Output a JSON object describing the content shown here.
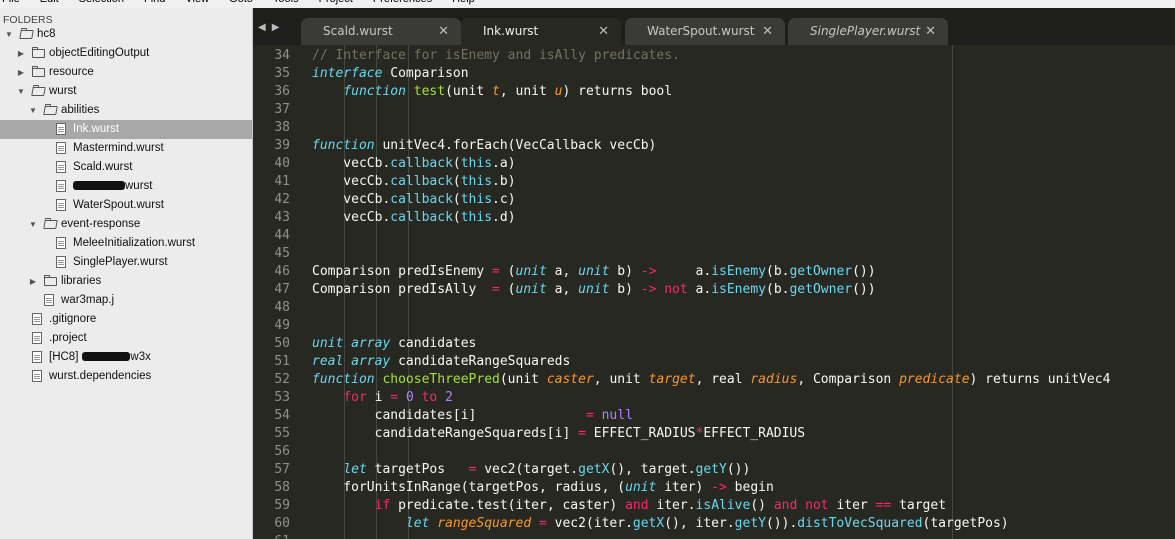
{
  "menu": [
    "File",
    "Edit",
    "Selection",
    "Find",
    "View",
    "Goto",
    "Tools",
    "Project",
    "Preferences",
    "Help"
  ],
  "sidebar": {
    "header": "FOLDERS",
    "tree": [
      {
        "label": "hc8",
        "type": "folder",
        "open": true,
        "depth": 0
      },
      {
        "label": "objectEditingOutput",
        "type": "folder",
        "open": false,
        "depth": 1
      },
      {
        "label": "resource",
        "type": "folder",
        "open": false,
        "depth": 1
      },
      {
        "label": "wurst",
        "type": "folder",
        "open": true,
        "depth": 1
      },
      {
        "label": "abilities",
        "type": "folder",
        "open": true,
        "depth": 2
      },
      {
        "label": "Ink.wurst",
        "type": "file",
        "depth": 3,
        "selected": true
      },
      {
        "label": "Mastermind.wurst",
        "type": "file",
        "depth": 3
      },
      {
        "label": "Scald.wurst",
        "type": "file",
        "depth": 3
      },
      {
        "label": "wurst",
        "type": "file",
        "depth": 3,
        "redacted": "pre"
      },
      {
        "label": "WaterSpout.wurst",
        "type": "file",
        "depth": 3
      },
      {
        "label": "event-response",
        "type": "folder",
        "open": true,
        "depth": 2
      },
      {
        "label": "MeleeInitialization.wurst",
        "type": "file",
        "depth": 3
      },
      {
        "label": "SinglePlayer.wurst",
        "type": "file",
        "depth": 3
      },
      {
        "label": "libraries",
        "type": "folder",
        "open": false,
        "depth": 2
      },
      {
        "label": "war3map.j",
        "type": "file",
        "depth": 2
      },
      {
        "label": ".gitignore",
        "type": "file",
        "depth": 1
      },
      {
        "label": ".project",
        "type": "file",
        "depth": 1
      },
      {
        "label": "[HC8]",
        "label_after": "w3x",
        "type": "file",
        "depth": 1,
        "redacted": "mid"
      },
      {
        "label": "wurst.dependencies",
        "type": "file",
        "depth": 1
      }
    ]
  },
  "tabs": [
    {
      "label": "Scald.wurst",
      "active": false,
      "italic": false
    },
    {
      "label": "Ink.wurst",
      "active": true,
      "italic": false
    },
    {
      "label": "WaterSpout.wurst",
      "active": false,
      "italic": false
    },
    {
      "label": "SinglePlayer.wurst",
      "active": false,
      "italic": true
    }
  ],
  "editor": {
    "line_numbers": [
      34,
      35,
      36,
      37,
      38,
      39,
      40,
      41,
      42,
      43,
      44,
      45,
      46,
      47,
      48,
      49,
      50,
      51,
      52,
      53,
      54,
      55,
      56,
      57,
      58,
      59,
      60,
      61
    ],
    "lines": [
      [
        [
          "c",
          "// Interface for isEnemy and isAlly predicates."
        ]
      ],
      [
        [
          "k",
          "interface"
        ],
        [
          "t",
          " Comparison"
        ]
      ],
      [
        [
          "t",
          "    "
        ],
        [
          "k",
          "function"
        ],
        [
          "t",
          " "
        ],
        [
          "f",
          "test"
        ],
        [
          "t",
          "(unit "
        ],
        [
          "p",
          "t"
        ],
        [
          "t",
          ", unit "
        ],
        [
          "p",
          "u"
        ],
        [
          "t",
          ") returns bool"
        ]
      ],
      [],
      [],
      [
        [
          "k",
          "function"
        ],
        [
          "t",
          " unitVec4.forEach(VecCallback vecCb)"
        ]
      ],
      [
        [
          "t",
          "    vecCb."
        ],
        [
          "b",
          "callback"
        ],
        [
          "t",
          "("
        ],
        [
          "b",
          "this"
        ],
        [
          "t",
          ".a)"
        ]
      ],
      [
        [
          "t",
          "    vecCb."
        ],
        [
          "b",
          "callback"
        ],
        [
          "t",
          "("
        ],
        [
          "b",
          "this"
        ],
        [
          "t",
          ".b)"
        ]
      ],
      [
        [
          "t",
          "    vecCb."
        ],
        [
          "b",
          "callback"
        ],
        [
          "t",
          "("
        ],
        [
          "b",
          "this"
        ],
        [
          "t",
          ".c)"
        ]
      ],
      [
        [
          "t",
          "    vecCb."
        ],
        [
          "b",
          "callback"
        ],
        [
          "t",
          "("
        ],
        [
          "b",
          "this"
        ],
        [
          "t",
          ".d)"
        ]
      ],
      [],
      [],
      [
        [
          "t",
          "Comparison predIsEnemy "
        ],
        [
          "o",
          "="
        ],
        [
          "t",
          " ("
        ],
        [
          "k",
          "unit"
        ],
        [
          "t",
          " a, "
        ],
        [
          "k",
          "unit"
        ],
        [
          "t",
          " b) "
        ],
        [
          "o",
          "->"
        ],
        [
          "t",
          "     a."
        ],
        [
          "b",
          "isEnemy"
        ],
        [
          "t",
          "(b."
        ],
        [
          "b",
          "getOwner"
        ],
        [
          "t",
          "())"
        ]
      ],
      [
        [
          "t",
          "Comparison predIsAlly  "
        ],
        [
          "o",
          "="
        ],
        [
          "t",
          " ("
        ],
        [
          "k",
          "unit"
        ],
        [
          "t",
          " a, "
        ],
        [
          "k",
          "unit"
        ],
        [
          "t",
          " b) "
        ],
        [
          "o",
          "->"
        ],
        [
          "t",
          " "
        ],
        [
          "o",
          "not"
        ],
        [
          "t",
          " a."
        ],
        [
          "b",
          "isEnemy"
        ],
        [
          "t",
          "(b."
        ],
        [
          "b",
          "getOwner"
        ],
        [
          "t",
          "())"
        ]
      ],
      [],
      [],
      [
        [
          "k",
          "unit"
        ],
        [
          "t",
          " "
        ],
        [
          "k",
          "array"
        ],
        [
          "t",
          " candidates"
        ]
      ],
      [
        [
          "k",
          "real"
        ],
        [
          "t",
          " "
        ],
        [
          "k",
          "array"
        ],
        [
          "t",
          " candidateRangeSquareds"
        ]
      ],
      [
        [
          "k",
          "function"
        ],
        [
          "t",
          " "
        ],
        [
          "f",
          "chooseThreePred"
        ],
        [
          "t",
          "(unit "
        ],
        [
          "p",
          "caster"
        ],
        [
          "t",
          ", unit "
        ],
        [
          "p",
          "target"
        ],
        [
          "t",
          ", real "
        ],
        [
          "p",
          "radius"
        ],
        [
          "t",
          ", Comparison "
        ],
        [
          "p",
          "predicate"
        ],
        [
          "t",
          ") returns unitVec4"
        ]
      ],
      [
        [
          "t",
          "    "
        ],
        [
          "o",
          "for"
        ],
        [
          "t",
          " i "
        ],
        [
          "o",
          "="
        ],
        [
          "t",
          " "
        ],
        [
          "n",
          "0"
        ],
        [
          "t",
          " "
        ],
        [
          "o",
          "to"
        ],
        [
          "t",
          " "
        ],
        [
          "n",
          "2"
        ]
      ],
      [
        [
          "t",
          "        candidates[i]              "
        ],
        [
          "o",
          "="
        ],
        [
          "t",
          " "
        ],
        [
          "n",
          "null"
        ]
      ],
      [
        [
          "t",
          "        candidateRangeSquareds[i] "
        ],
        [
          "o",
          "="
        ],
        [
          "t",
          " EFFECT_RADIUS"
        ],
        [
          "o",
          "*"
        ],
        [
          "t",
          "EFFECT_RADIUS"
        ]
      ],
      [],
      [
        [
          "t",
          "    "
        ],
        [
          "k",
          "let"
        ],
        [
          "t",
          " targetPos   "
        ],
        [
          "o",
          "="
        ],
        [
          "t",
          " vec2(target."
        ],
        [
          "b",
          "getX"
        ],
        [
          "t",
          "(), target."
        ],
        [
          "b",
          "getY"
        ],
        [
          "t",
          "())"
        ]
      ],
      [
        [
          "t",
          "    forUnitsInRange(targetPos, radius, ("
        ],
        [
          "k",
          "unit"
        ],
        [
          "t",
          " iter) "
        ],
        [
          "o",
          "->"
        ],
        [
          "t",
          " begin"
        ]
      ],
      [
        [
          "t",
          "        "
        ],
        [
          "o",
          "if"
        ],
        [
          "t",
          " predicate.test(iter, caster) "
        ],
        [
          "o",
          "and"
        ],
        [
          "t",
          " iter."
        ],
        [
          "b",
          "isAlive"
        ],
        [
          "t",
          "() "
        ],
        [
          "o",
          "and"
        ],
        [
          "t",
          " "
        ],
        [
          "o",
          "not"
        ],
        [
          "t",
          " iter "
        ],
        [
          "o",
          "=="
        ],
        [
          "t",
          " target"
        ]
      ],
      [
        [
          "t",
          "            "
        ],
        [
          "k",
          "let"
        ],
        [
          "t",
          " "
        ],
        [
          "p",
          "rangeSquared"
        ],
        [
          "t",
          " "
        ],
        [
          "o",
          "="
        ],
        [
          "t",
          " vec2(iter."
        ],
        [
          "b",
          "getX"
        ],
        [
          "t",
          "(), iter."
        ],
        [
          "b",
          "getY"
        ],
        [
          "t",
          "())."
        ],
        [
          "b",
          "distToVecSquared"
        ],
        [
          "t",
          "(targetPos)"
        ]
      ],
      []
    ]
  }
}
